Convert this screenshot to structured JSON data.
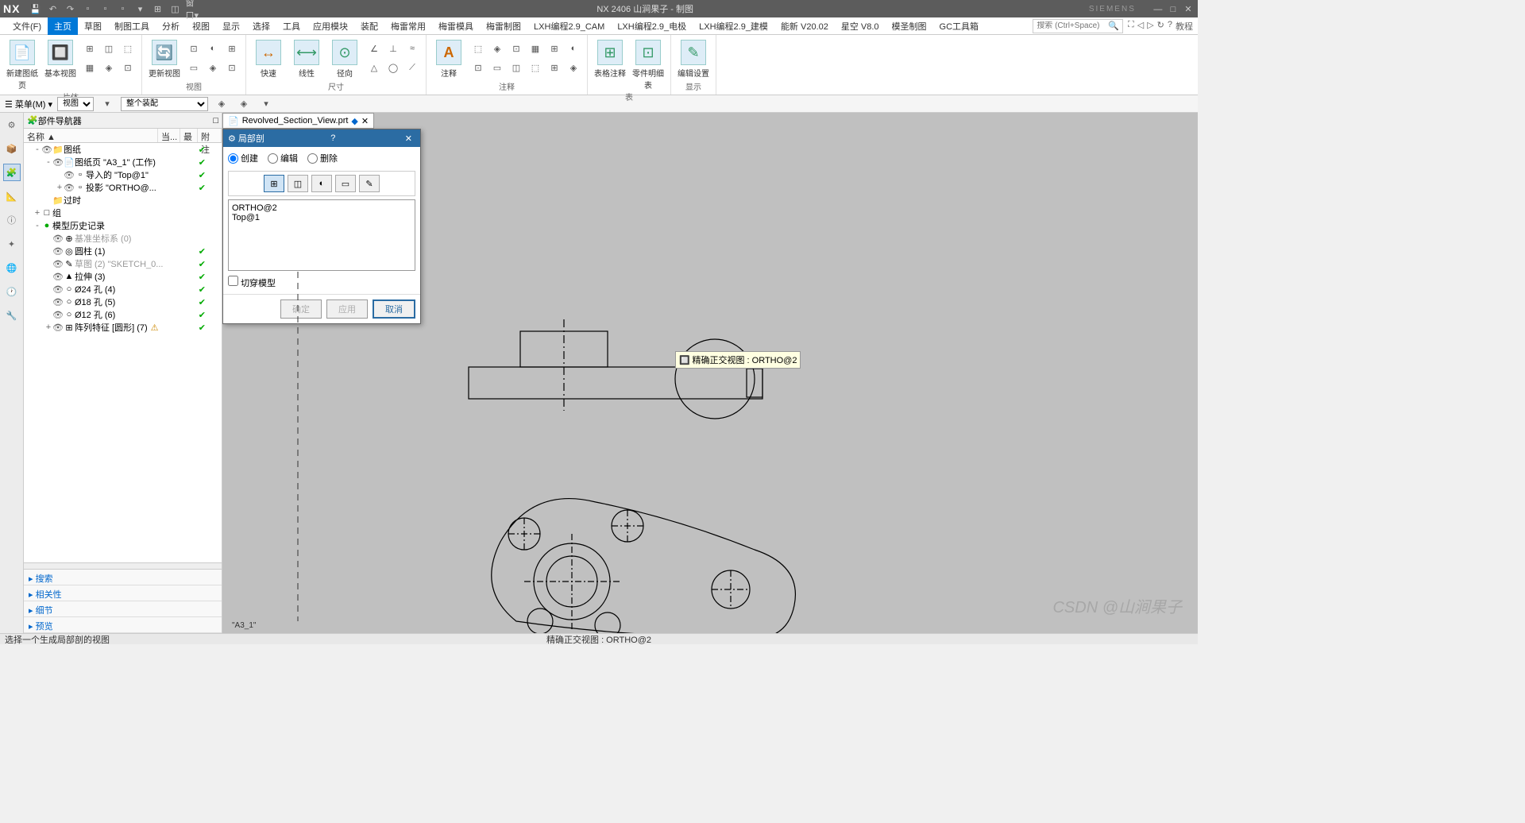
{
  "title": {
    "app": "NX",
    "doc": "NX 2406 山涧果子 - 制图",
    "brand": "SIEMENS"
  },
  "qat": [
    "save",
    "undo",
    "redo",
    "cut",
    "copy",
    "paste",
    "touch",
    "window",
    "more"
  ],
  "menu": {
    "items": [
      "文件(F)",
      "主页",
      "草图",
      "制图工具",
      "分析",
      "视图",
      "显示",
      "选择",
      "工具",
      "应用模块",
      "装配",
      "梅雷常用",
      "梅雷模具",
      "梅雷制图",
      "LXH编程2.9_CAM",
      "LXH编程2.9_电极",
      "LXH编程2.9_建模",
      "能新 V20.02",
      "星空 V8.0",
      "模圣制图",
      "GC工具箱"
    ],
    "active": 1,
    "search_placeholder": "搜索 (Ctrl+Space)",
    "right_icons": [
      "expand",
      "back",
      "fwd",
      "refresh",
      "help",
      "tutorial"
    ],
    "tutorial_label": "教程"
  },
  "ribbon": {
    "groups": [
      {
        "label": "片体",
        "big": [
          {
            "label": "新建图纸页",
            "icon": "📄"
          },
          {
            "label": "基本视图",
            "icon": "🔲"
          }
        ],
        "small": [
          "⊞",
          "◫",
          "⬚",
          "▦",
          "◈",
          "⊡"
        ]
      },
      {
        "label": "视图",
        "big": [
          {
            "label": "更新视图",
            "icon": "🔄"
          }
        ],
        "small": [
          "⊡",
          "◐",
          "⊞",
          "▭",
          "◈",
          "⊡"
        ]
      },
      {
        "label": "尺寸",
        "big": [
          {
            "label": "快速",
            "icon": "↔"
          },
          {
            "label": "线性",
            "icon": "⟷"
          },
          {
            "label": "径向",
            "icon": "⊙"
          }
        ],
        "small": [
          "∠",
          "⊥",
          "≈",
          "△",
          "◯",
          "⟋"
        ]
      },
      {
        "label": "注释",
        "big": [
          {
            "label": "注释",
            "icon": "A"
          }
        ],
        "small": [
          "⬚",
          "◈",
          "⊡",
          "▦",
          "⊞",
          "◐",
          "⊡",
          "▭",
          "◫",
          "⬚",
          "⊞",
          "◈"
        ]
      },
      {
        "label": "表",
        "big": [
          {
            "label": "表格注释",
            "icon": "⊞"
          },
          {
            "label": "零件明细表",
            "icon": "⊡"
          }
        ]
      },
      {
        "label": "显示",
        "big": [
          {
            "label": "编辑设置",
            "icon": "✎"
          }
        ]
      }
    ]
  },
  "quickbar": {
    "menu_label": "菜单(M)",
    "sel1": "视图",
    "sel2": "整个装配"
  },
  "navigator": {
    "title": "部件导航器",
    "cols": [
      "名称 ▲",
      "当...",
      "最",
      "附注"
    ],
    "tree": [
      {
        "d": 0,
        "exp": "-",
        "ico": "📁",
        "txt": "图纸",
        "chk": true,
        "vis": true
      },
      {
        "d": 1,
        "exp": "-",
        "ico": "📄",
        "txt": "图纸页 \"A3_1\" (工作)",
        "chk": true,
        "vis": true
      },
      {
        "d": 2,
        "exp": "",
        "ico": "▫",
        "txt": "导入的 \"Top@1\"",
        "chk": true,
        "vis": true
      },
      {
        "d": 2,
        "exp": "+",
        "ico": "▫",
        "txt": "投影 \"ORTHO@...",
        "chk": true,
        "vis": true
      },
      {
        "d": 1,
        "exp": "",
        "ico": "📁",
        "txt": "过时",
        "chk": false
      },
      {
        "d": 0,
        "exp": "+",
        "ico": "□",
        "txt": "组",
        "chk": false
      },
      {
        "d": 0,
        "exp": "-",
        "ico": "●",
        "txt": "模型历史记录",
        "chk": false,
        "green": true
      },
      {
        "d": 1,
        "exp": "",
        "ico": "⊕",
        "txt": "基准坐标系 (0)",
        "chk": false,
        "dim": true,
        "vis": true
      },
      {
        "d": 1,
        "exp": "",
        "ico": "◎",
        "txt": "圆柱 (1)",
        "chk": true,
        "vis": true
      },
      {
        "d": 1,
        "exp": "",
        "ico": "✎",
        "txt": "草图 (2) \"SKETCH_0...",
        "chk": true,
        "dim": true,
        "vis": true
      },
      {
        "d": 1,
        "exp": "",
        "ico": "▲",
        "txt": "拉伸 (3)",
        "chk": true,
        "vis": true
      },
      {
        "d": 1,
        "exp": "",
        "ico": "○",
        "txt": "Ø24 孔 (4)",
        "chk": true,
        "vis": true
      },
      {
        "d": 1,
        "exp": "",
        "ico": "○",
        "txt": "Ø18 孔 (5)",
        "chk": true,
        "vis": true
      },
      {
        "d": 1,
        "exp": "",
        "ico": "○",
        "txt": "Ø12 孔 (6)",
        "chk": true,
        "vis": true
      },
      {
        "d": 1,
        "exp": "+",
        "ico": "⊞",
        "txt": "阵列特征 [圆形] (7)",
        "chk": true,
        "vis": true,
        "warn": true
      }
    ],
    "sections": [
      "搜索",
      "相关性",
      "细节",
      "预览"
    ]
  },
  "file_tab": {
    "name": "Revolved_Section_View.prt",
    "dirty": "◆"
  },
  "dialog": {
    "title": "局部剖",
    "radios": [
      {
        "label": "创建",
        "checked": true
      },
      {
        "label": "编辑",
        "checked": false
      },
      {
        "label": "删除",
        "checked": false
      }
    ],
    "list": [
      "ORTHO@2",
      "Top@1"
    ],
    "checkbox": "切穿模型",
    "buttons": {
      "ok": "确定",
      "apply": "应用",
      "cancel": "取消"
    }
  },
  "tooltip": {
    "text": "精确正交视图 : ORTHO@2"
  },
  "sheet_label": "\"A3_1\"",
  "status": {
    "left": "选择一个生成局部剖的视图",
    "center": "精确正交视图 : ORTHO@2"
  },
  "watermark": "CSDN @山涧果子"
}
